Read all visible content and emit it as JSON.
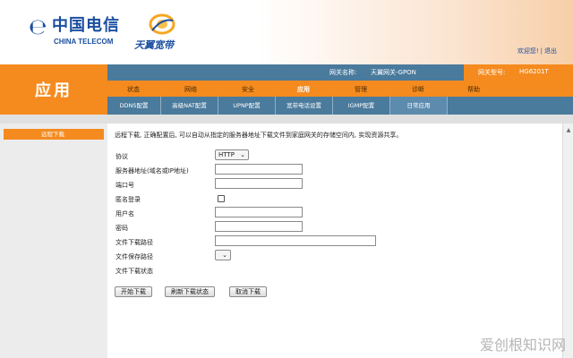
{
  "colors": {
    "orange": "#f58b1f",
    "steel_blue": "#4a7a9c",
    "brand_blue": "#1a4ea0"
  },
  "header": {
    "logo_icon": "china-telecom-logo-icon",
    "logo_cn": "中国电信",
    "logo_en": "CHINA TELECOM",
    "brand2_icon": "tianyi-swirl-icon",
    "brand2_text": "天翼宽带",
    "welcome_link": "欢迎您!",
    "logout_link": "退出"
  },
  "app_banner": "应用",
  "infobar": {
    "gateway_label": "网关名称:",
    "gateway_value": "天翼网关-GPON",
    "model_label": "网关型号:",
    "model_value": "HG6201T"
  },
  "main_nav": [
    {
      "label": "状态"
    },
    {
      "label": "网络"
    },
    {
      "label": "安全"
    },
    {
      "label": "应用",
      "active": true
    },
    {
      "label": "管理"
    },
    {
      "label": "诊断"
    },
    {
      "label": "帮助"
    }
  ],
  "sub_nav": [
    {
      "label": "DDNS配置"
    },
    {
      "label": "高级NAT配置"
    },
    {
      "label": "UPNP配置"
    },
    {
      "label": "宽带电话设置"
    },
    {
      "label": "IGMP配置"
    },
    {
      "label": "日常应用",
      "active": true
    }
  ],
  "sidebar": {
    "items": [
      {
        "label": "远程下载"
      }
    ]
  },
  "form": {
    "description": "远程下载, 正确配置后, 可以自动从指定的服务器地址下载文件到家庭网关的存储空间内, 实现资源共享。",
    "protocol_label": "协议",
    "protocol_value": "HTTP",
    "server_label": "服务器地址(域名或IP地址)",
    "server_value": "",
    "port_label": "端口号",
    "port_value": "",
    "anonymous_label": "匿名登录",
    "anonymous_checked": false,
    "username_label": "用户名",
    "username_value": "",
    "password_label": "密码",
    "password_value": "",
    "download_path_label": "文件下载路径",
    "download_path_value": "",
    "save_path_label": "文件保存路径",
    "save_path_value": "",
    "status_label": "文件下载状态"
  },
  "buttons": {
    "start": "开始下载",
    "refresh": "刷新下载状态",
    "cancel": "取消下载"
  },
  "watermark": "爱创根知识网"
}
